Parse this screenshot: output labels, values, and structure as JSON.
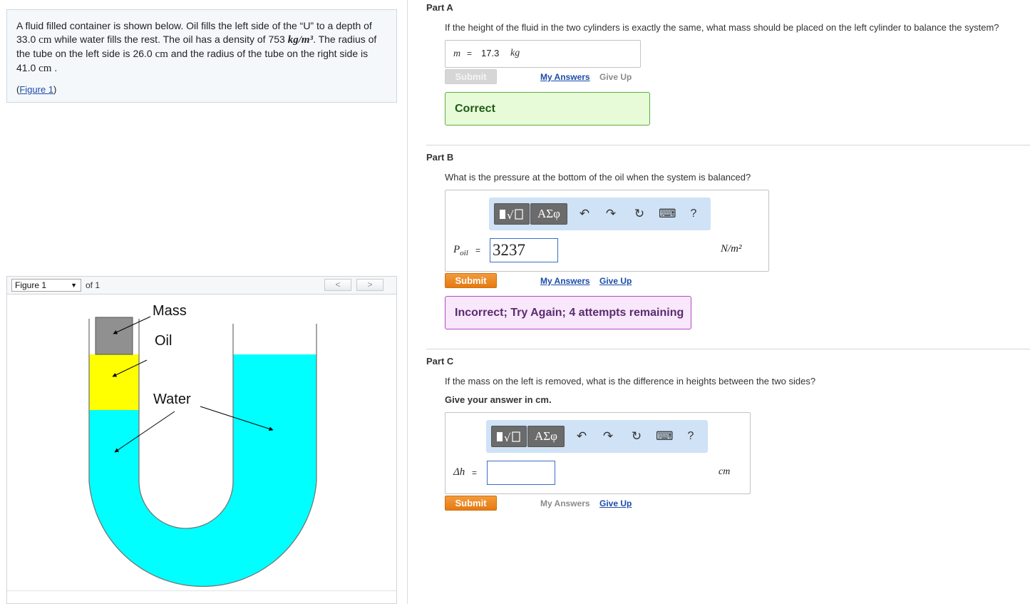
{
  "problem": {
    "seg1": "A fluid filled container is shown below.  Oil fills the left side of the “U” to a depth of ",
    "depth": "33.0",
    "unit_cm_1": "cm",
    "seg2": " while water fills the rest.  The oil has a density of ",
    "density": "753",
    "density_unit": "kg/m³",
    "seg3": ".  The radius of the tube on the left side is ",
    "radius_left": "26.0",
    "unit_cm_2": "cm",
    "seg4": " and the radius of the tube on the right side is ",
    "radius_right": "41.0",
    "unit_cm_3": "cm",
    "seg5": " .",
    "figure_link_open": "(",
    "figure_link": "Figure 1",
    "figure_link_close": ")"
  },
  "figure_panel": {
    "selected": "Figure 1",
    "of_label": "of 1",
    "prev_glyph": "<",
    "next_glyph": ">",
    "labels": {
      "mass": "Mass",
      "oil": "Oil",
      "water": "Water"
    },
    "colors": {
      "mass": "#909090",
      "oil": "#ffff00",
      "water": "#00ffff"
    }
  },
  "partA": {
    "title": "Part A",
    "question": "If the height of the fluid in the two cylinders is exactly the same, what mass should be placed on the left cylinder to balance the system?",
    "var": "m",
    "equals": "=",
    "value": "17.3",
    "unit": "kg",
    "submit": "Submit",
    "my_answers": "My Answers",
    "give_up": "Give Up",
    "feedback": "Correct"
  },
  "partB": {
    "title": "Part B",
    "question": "What is the pressure at the bottom of the oil when the system is balanced?",
    "var": "P",
    "var_sub": "oil",
    "equals": "=",
    "value": "3237",
    "unit": "N/m²",
    "submit": "Submit",
    "my_answers": "My Answers",
    "give_up": "Give Up",
    "feedback": "Incorrect; Try Again; 4 attempts remaining"
  },
  "partC": {
    "title": "Part C",
    "question": "If the mass on the left is removed, what is the difference in heights between the two sides?",
    "instruction": "Give your answer in cm.",
    "var": "Δh",
    "equals": "=",
    "value": "",
    "unit": "cm",
    "submit": "Submit",
    "my_answers": "My Answers",
    "give_up": "Give Up"
  },
  "toolbar": {
    "greek": "ΑΣφ",
    "undo_glyph": "↶",
    "redo_glyph": "↷",
    "reset_glyph": "↻",
    "keyboard_glyph": "⌨",
    "help": "?",
    "icons": [
      "templates-icon",
      "greek-symbols-icon",
      "undo-icon",
      "redo-icon",
      "reset-icon",
      "keyboard-icon",
      "help-icon"
    ]
  }
}
